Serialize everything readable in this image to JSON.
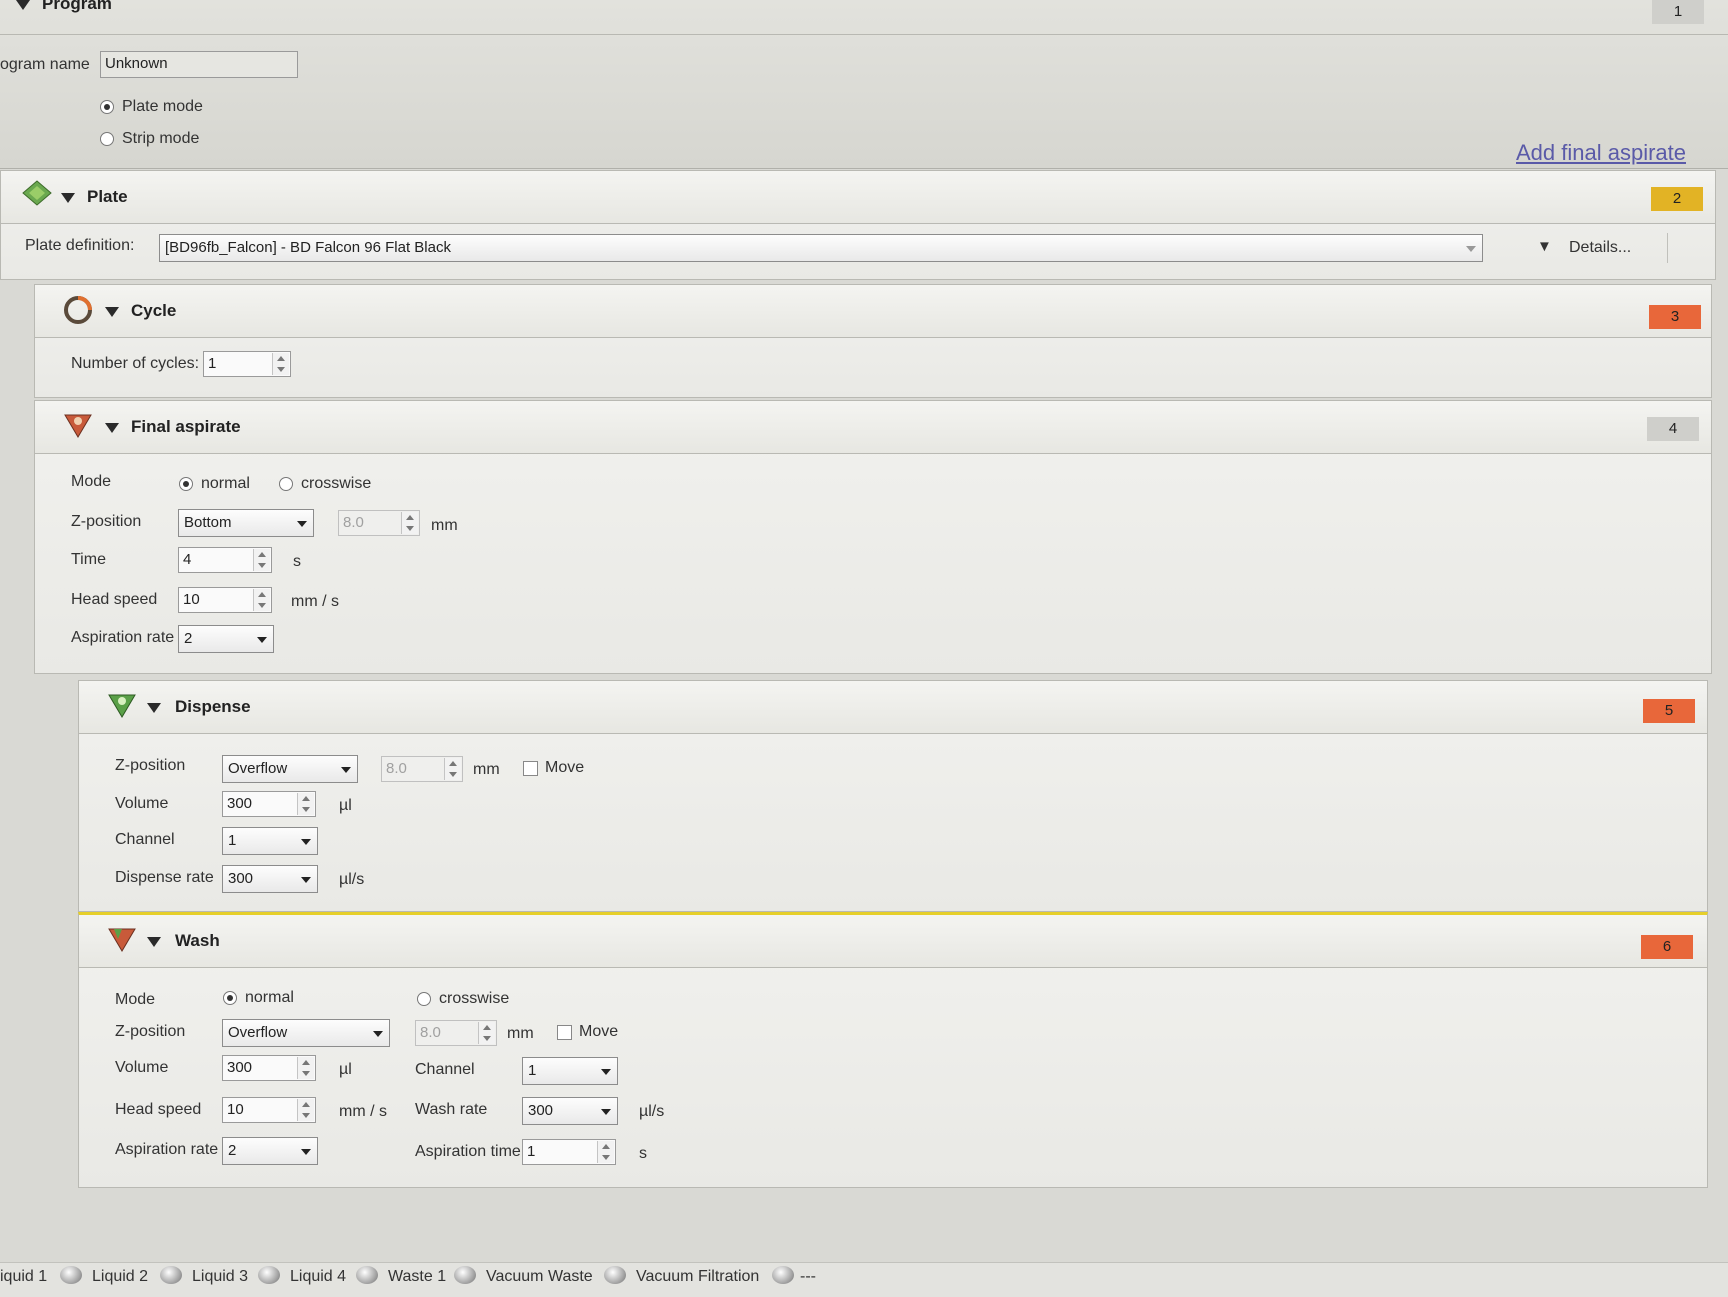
{
  "program": {
    "title": "Program",
    "number": "1",
    "name_label": "ogram name",
    "name_value": "Unknown",
    "plate_mode": "Plate mode",
    "strip_mode": "Strip mode",
    "add_link": "Add final aspirate"
  },
  "plate": {
    "title": "Plate",
    "number": "2",
    "definition_label": "Plate definition:",
    "definition_value": "[BD96fb_Falcon] - BD Falcon 96 Flat Black",
    "details": "Details..."
  },
  "cycle": {
    "title": "Cycle",
    "number": "3",
    "cycles_label": "Number of cycles:",
    "cycles_value": "1"
  },
  "final_aspirate": {
    "title": "Final aspirate",
    "number": "4",
    "mode_label": "Mode",
    "normal": "normal",
    "crosswise": "crosswise",
    "z_label": "Z-position",
    "z_value": "Bottom",
    "z_mm": "8.0",
    "mm": "mm",
    "time_label": "Time",
    "time_value": "4",
    "s": "s",
    "speed_label": "Head speed",
    "speed_value": "10",
    "speed_unit": "mm / s",
    "rate_label": "Aspiration rate",
    "rate_value": "2"
  },
  "dispense": {
    "title": "Dispense",
    "number": "5",
    "z_label": "Z-position",
    "z_value": "Overflow",
    "z_mm": "8.0",
    "mm": "mm",
    "move": "Move",
    "volume_label": "Volume",
    "volume_value": "300",
    "ul": "µl",
    "channel_label": "Channel",
    "channel_value": "1",
    "rate_label": "Dispense rate",
    "rate_value": "300",
    "rate_unit": "µl/s"
  },
  "wash": {
    "title": "Wash",
    "number": "6",
    "mode_label": "Mode",
    "normal": "normal",
    "crosswise": "crosswise",
    "z_label": "Z-position",
    "z_value": "Overflow",
    "z_mm": "8.0",
    "mm": "mm",
    "move": "Move",
    "volume_label": "Volume",
    "volume_value": "300",
    "ul": "µl",
    "channel_label": "Channel",
    "channel_value": "1",
    "speed_label": "Head speed",
    "speed_value": "10",
    "speed_unit": "mm / s",
    "washrate_label": "Wash rate",
    "washrate_value": "300",
    "washrate_unit": "µl/s",
    "asprate_label": "Aspiration rate",
    "asprate_value": "2",
    "asptime_label": "Aspiration time",
    "asptime_value": "1",
    "s": "s"
  },
  "footer": [
    "iquid 1",
    "Liquid 2",
    "Liquid 3",
    "Liquid 4",
    "Waste 1",
    "Vacuum Waste",
    "Vacuum Filtration",
    "---"
  ],
  "colors": {
    "badge_yellow": "#e2b325",
    "badge_orange": "#e8673a",
    "badge_gray": "#cfcfcb",
    "link": "#5a5aa8"
  }
}
